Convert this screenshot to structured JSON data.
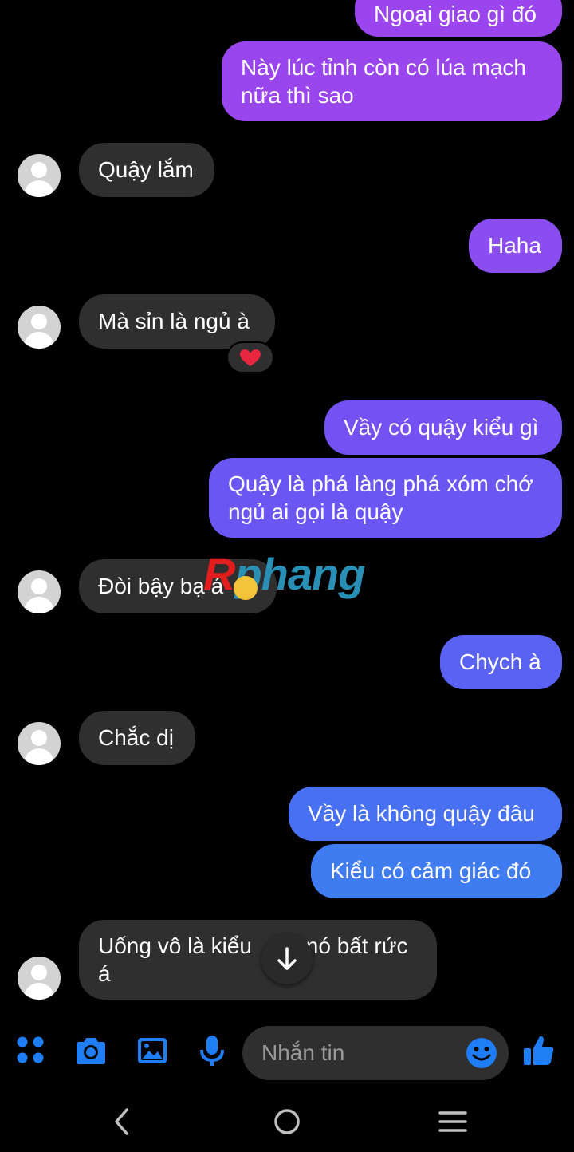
{
  "messages": [
    {
      "dir": "out",
      "text": "Ngoại giao gì đó"
    },
    {
      "dir": "out",
      "text": "Này lúc tỉnh còn có lúa mạch nữa thì sao"
    },
    {
      "dir": "in",
      "text": "Quậy lắm"
    },
    {
      "dir": "out",
      "text": "Haha"
    },
    {
      "dir": "in",
      "text": "Mà sỉn là ngủ à",
      "reaction": "❤️"
    },
    {
      "dir": "out",
      "text": "Vầy có quậy kiểu gì"
    },
    {
      "dir": "out",
      "text": "Quậy là phá làng phá xóm chớ ngủ ai gọi là quậy"
    },
    {
      "dir": "in",
      "text": "Đòi bậy bạ á"
    },
    {
      "dir": "out",
      "text": "Chych à"
    },
    {
      "dir": "in",
      "text": "Chắc dị"
    },
    {
      "dir": "out",
      "text": "Vầy là không quậy đâu"
    },
    {
      "dir": "out",
      "text": "Kiểu có cảm giác đó"
    },
    {
      "dir": "in",
      "text_left": "Uống vô là kiểu ",
      "text_right": "nó bất rức",
      "text_line2": "á"
    }
  ],
  "watermark": {
    "first": "R",
    "rest": "phang"
  },
  "composer": {
    "placeholder": "Nhắn tin",
    "icons": [
      "apps-icon",
      "camera-icon",
      "gallery-icon",
      "microphone-icon",
      "emoji-icon",
      "thumbs-up-icon"
    ]
  },
  "navbar": {
    "icons": [
      "back-icon",
      "home-icon",
      "recents-icon"
    ]
  },
  "colors": {
    "background": "#000000",
    "incoming_bubble": "#2f2f2f",
    "outgoing_purple": "#8a4df0",
    "outgoing_blue": "#3f7cf2",
    "accent": "#1f7ef5",
    "heart": "#e8263f"
  }
}
